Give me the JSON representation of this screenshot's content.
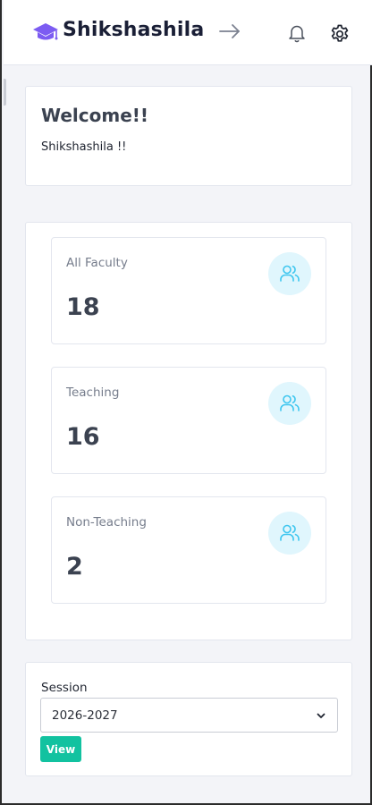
{
  "header": {
    "brand_name": "Shikshashila",
    "brand_icon": "graduation-cap-icon",
    "brand_color": "#7c5cf2",
    "actions": [
      "arrow-right-icon",
      "bell-icon",
      "gear-icon"
    ]
  },
  "welcome": {
    "title": "Welcome!!",
    "subtitle": "Shikshashila !!"
  },
  "stats": [
    {
      "label": "All Faculty",
      "value": "18",
      "icon": "users-icon"
    },
    {
      "label": "Teaching",
      "value": "16",
      "icon": "users-icon"
    },
    {
      "label": "Non-Teaching",
      "value": "2",
      "icon": "users-icon"
    }
  ],
  "session": {
    "label": "Session",
    "selected": "2026-2027",
    "button_label": "View",
    "button_color": "#12c2a0"
  },
  "colors": {
    "accent_icon": "#3ec6ef",
    "icon_bg": "#e0f6fd"
  }
}
